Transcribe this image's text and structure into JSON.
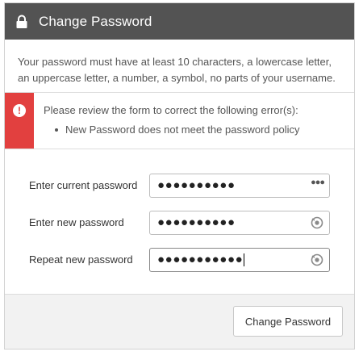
{
  "header": {
    "title": "Change Password",
    "icon": "lock-icon"
  },
  "intro": {
    "text": "Your password must have at least 10 characters, a lowercase letter, an uppercase letter, a number, a symbol, no parts of your username."
  },
  "alert": {
    "icon": "error-icon",
    "message": "Please review the form to correct the following error(s):",
    "errors": [
      "New Password does not meet the password policy"
    ],
    "color": "#e2403f"
  },
  "form": {
    "fields": [
      {
        "label": "Enter current password",
        "value": "●●●●●●●●●●",
        "trailing_icon": "password-manager-dots-icon"
      },
      {
        "label": "Enter new password",
        "value": "●●●●●●●●●●",
        "trailing_icon": "password-reveal-icon"
      },
      {
        "label": "Repeat new password",
        "value": "●●●●●●●●●●●",
        "trailing_icon": "password-reveal-icon"
      }
    ]
  },
  "footer": {
    "submit_label": "Change Password"
  },
  "colors": {
    "header_bg": "#535353",
    "footer_bg": "#f2f2f2"
  }
}
